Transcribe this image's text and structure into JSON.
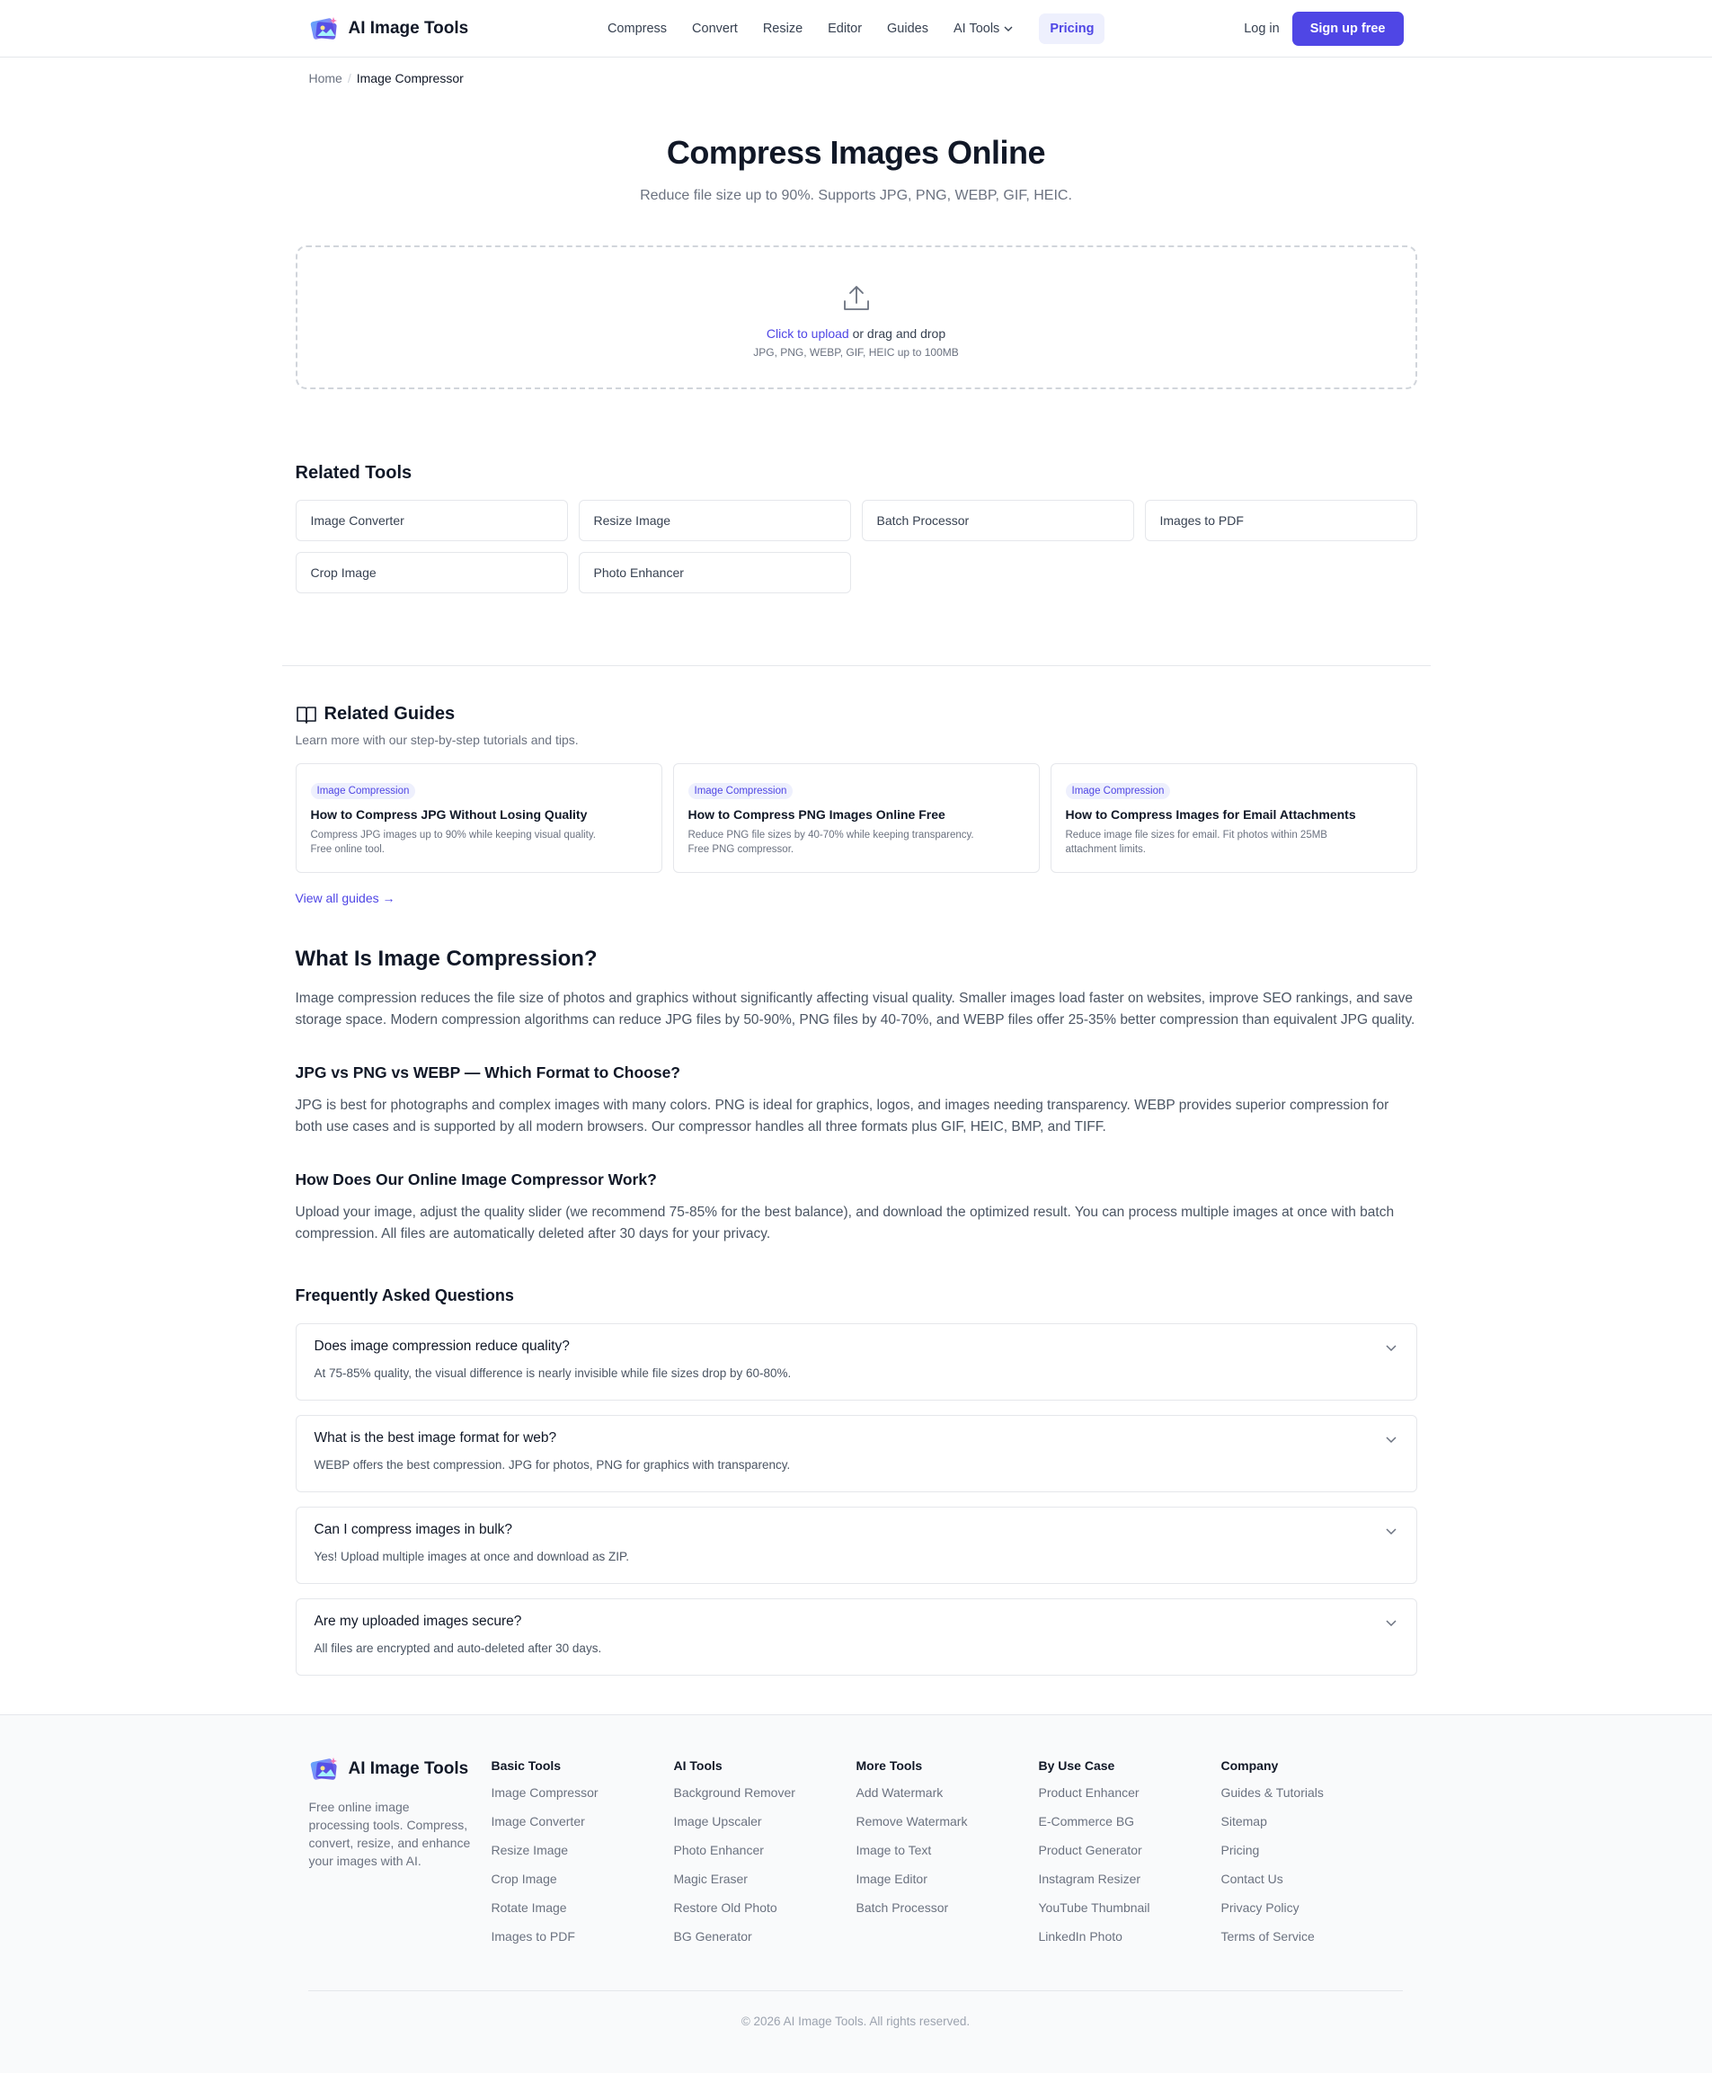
{
  "brand": {
    "name": "AI Image Tools"
  },
  "nav": {
    "items": [
      "Compress",
      "Convert",
      "Resize",
      "Editor",
      "Guides"
    ],
    "ai_tools": "AI Tools",
    "pricing": "Pricing",
    "login": "Log in",
    "signup": "Sign up free"
  },
  "breadcrumb": {
    "home": "Home",
    "sep": "/",
    "current": "Image Compressor"
  },
  "hero": {
    "title": "Compress Images Online",
    "subtitle": "Reduce file size up to 90%. Supports JPG, PNG, WEBP, GIF, HEIC.",
    "upload_link": "Click to upload",
    "upload_rest": " or drag and drop",
    "upload_hint": "JPG, PNG, WEBP, GIF, HEIC up to 100MB"
  },
  "related_tools": {
    "title": "Related Tools",
    "items": [
      "Image Converter",
      "Resize Image",
      "Batch Processor",
      "Images to PDF",
      "Crop Image",
      "Photo Enhancer"
    ]
  },
  "related_guides": {
    "title": "Related Guides",
    "subtitle": "Learn more with our step-by-step tutorials and tips.",
    "cards": [
      {
        "tag": "Image Compression",
        "title": "How to Compress JPG Without Losing Quality",
        "desc_line1": "Compress JPG images up to 90% while keeping visual quality.",
        "desc_line2": "Free online tool."
      },
      {
        "tag": "Image Compression",
        "title": "How to Compress PNG Images Online Free",
        "desc_line1": "Reduce PNG file sizes by 40-70% while keeping transparency.",
        "desc_line2": "Free PNG compressor."
      },
      {
        "tag": "Image Compression",
        "title": "How to Compress Images for Email Attachments",
        "desc_line1": "Reduce image file sizes for email. Fit photos within 25MB",
        "desc_line2": "attachment limits."
      }
    ],
    "view_all": "View all guides →"
  },
  "article": {
    "h2": "What Is Image Compression?",
    "p1": "Image compression reduces the file size of photos and graphics without significantly affecting visual quality. Smaller images load faster on websites, improve SEO rankings, and save storage space. Modern compression algorithms can reduce JPG files by 50-90%, PNG files by 40-70%, and WEBP files offer 25-35% better compression than equivalent JPG quality.",
    "h3a": "JPG vs PNG vs WEBP — Which Format to Choose?",
    "p2": "JPG is best for photographs and complex images with many colors. PNG is ideal for graphics, logos, and images needing transparency. WEBP provides superior compression for both use cases and is supported by all modern browsers. Our compressor handles all three formats plus GIF, HEIC, BMP, and TIFF.",
    "h3b": "How Does Our Online Image Compressor Work?",
    "p3": "Upload your image, adjust the quality slider (we recommend 75-85% for the best balance), and download the optimized result. You can process multiple images at once with batch compression. All files are automatically deleted after 30 days for your privacy."
  },
  "faq": {
    "title": "Frequently Asked Questions",
    "items": [
      {
        "q": "Does image compression reduce quality?",
        "a": "At 75-85% quality, the visual difference is nearly invisible while file sizes drop by 60-80%."
      },
      {
        "q": "What is the best image format for web?",
        "a": "WEBP offers the best compression. JPG for photos, PNG for graphics with transparency."
      },
      {
        "q": "Can I compress images in bulk?",
        "a": "Yes! Upload multiple images at once and download as ZIP."
      },
      {
        "q": "Are my uploaded images secure?",
        "a": "All files are encrypted and auto-deleted after 30 days."
      }
    ]
  },
  "footer": {
    "brand": "AI Image Tools",
    "desc": "Free online image processing tools. Compress, convert, resize, and enhance your images with AI.",
    "columns": [
      {
        "title": "Basic Tools",
        "links": [
          "Image Compressor",
          "Image Converter",
          "Resize Image",
          "Crop Image",
          "Rotate Image",
          "Images to PDF"
        ]
      },
      {
        "title": "AI Tools",
        "links": [
          "Background Remover",
          "Image Upscaler",
          "Photo Enhancer",
          "Magic Eraser",
          "Restore Old Photo",
          "BG Generator"
        ]
      },
      {
        "title": "More Tools",
        "links": [
          "Add Watermark",
          "Remove Watermark",
          "Image to Text",
          "Image Editor",
          "Batch Processor"
        ]
      },
      {
        "title": "By Use Case",
        "links": [
          "Product Enhancer",
          "E-Commerce BG",
          "Product Generator",
          "Instagram Resizer",
          "YouTube Thumbnail",
          "LinkedIn Photo"
        ]
      },
      {
        "title": "Company",
        "links": [
          "Guides & Tutorials",
          "Sitemap",
          "Pricing",
          "Contact Us",
          "Privacy Policy",
          "Terms of Service"
        ]
      }
    ],
    "copyright": "© 2026 AI Image Tools. All rights reserved."
  },
  "colors": {
    "accent": "#4f46e5",
    "accent_bg": "#eef0fd",
    "text": "#111827",
    "muted": "#6b7280",
    "border": "#e5e7eb"
  }
}
